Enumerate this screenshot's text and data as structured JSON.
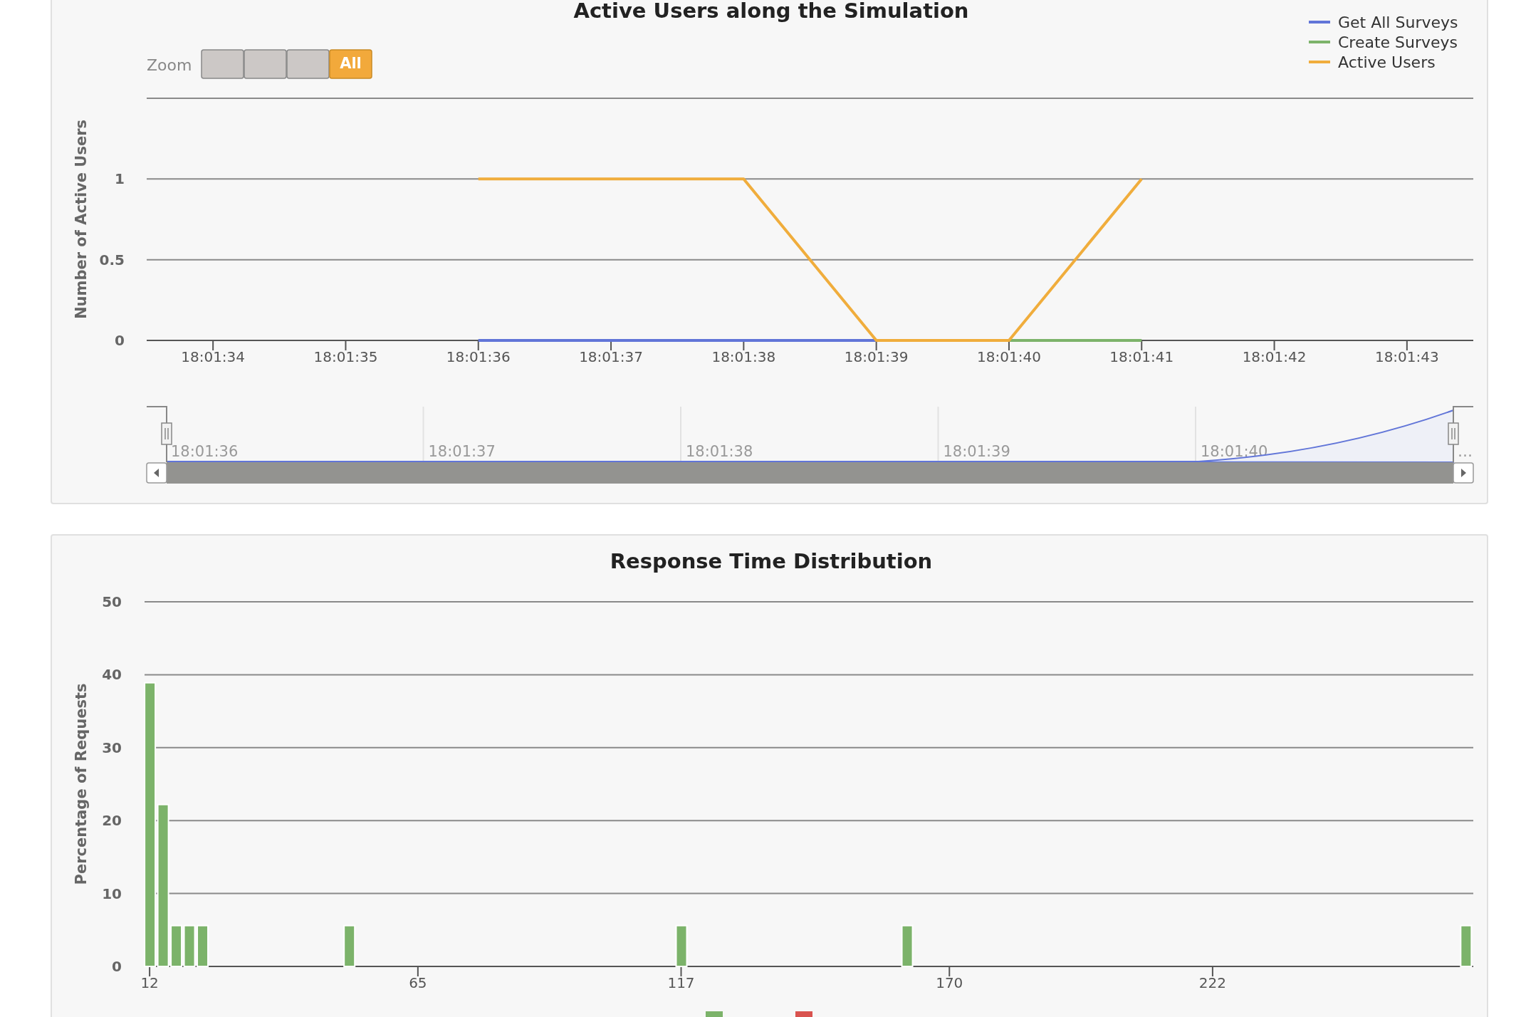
{
  "chart1": {
    "title": "Active Users along the Simulation",
    "zoom": {
      "label": "Zoom",
      "buttons": [
        {
          "selected": false,
          "disabled": true
        },
        {
          "selected": false,
          "disabled": true
        },
        {
          "selected": false,
          "disabled": true
        },
        {
          "label": "All",
          "selected": true,
          "disabled": false
        }
      ]
    },
    "chart_data": {
      "type": "line",
      "ylabel": "Number of Active Users",
      "categories": [
        "18:01:34",
        "18:01:35",
        "18:01:36",
        "18:01:37",
        "18:01:38",
        "18:01:39",
        "18:01:40",
        "18:01:41",
        "18:01:42",
        "18:01:43"
      ],
      "ylim": [
        0,
        1.5
      ],
      "grid": true,
      "yticks": [
        0,
        0.5,
        1
      ],
      "series": [
        {
          "name": "Get All Surveys",
          "color": "#6175d8",
          "values": [
            null,
            null,
            0,
            0,
            0,
            0,
            null,
            null,
            null,
            null
          ]
        },
        {
          "name": "Create Surveys",
          "color": "#7cb36a",
          "values": [
            null,
            null,
            null,
            null,
            null,
            null,
            0,
            0,
            null,
            null
          ]
        },
        {
          "name": "Active Users",
          "color": "#f0ad3c",
          "values": [
            null,
            null,
            1,
            1,
            1,
            0,
            0,
            1,
            null,
            null
          ]
        }
      ]
    },
    "navigator": {
      "labels": [
        "18:01:36",
        "18:01:37",
        "18:01:38",
        "18:01:39",
        "18:01:40"
      ],
      "overflow": "…"
    }
  },
  "chart2": {
    "title": "Response Time Distribution",
    "chart_data": {
      "type": "bar",
      "ylabel": "Percentage of Requests",
      "x": [
        12,
        14.6,
        17.2,
        19.8,
        22.4,
        51.4,
        117,
        161.6,
        272
      ],
      "xlim": [
        11,
        273.5
      ],
      "ylim": [
        0,
        50
      ],
      "xticks": [
        12,
        65,
        117,
        170,
        222
      ],
      "yticks": [
        0,
        10,
        20,
        30,
        40,
        50
      ],
      "grid": true,
      "series": [
        {
          "color": "#7cb36a",
          "values": [
            38.9,
            22.2,
            5.6,
            5.6,
            5.6,
            5.6,
            5.6,
            5.6,
            5.6
          ]
        }
      ]
    },
    "legend": [
      {
        "color": "#7cb36a"
      },
      {
        "color": "#d9534f"
      }
    ]
  }
}
